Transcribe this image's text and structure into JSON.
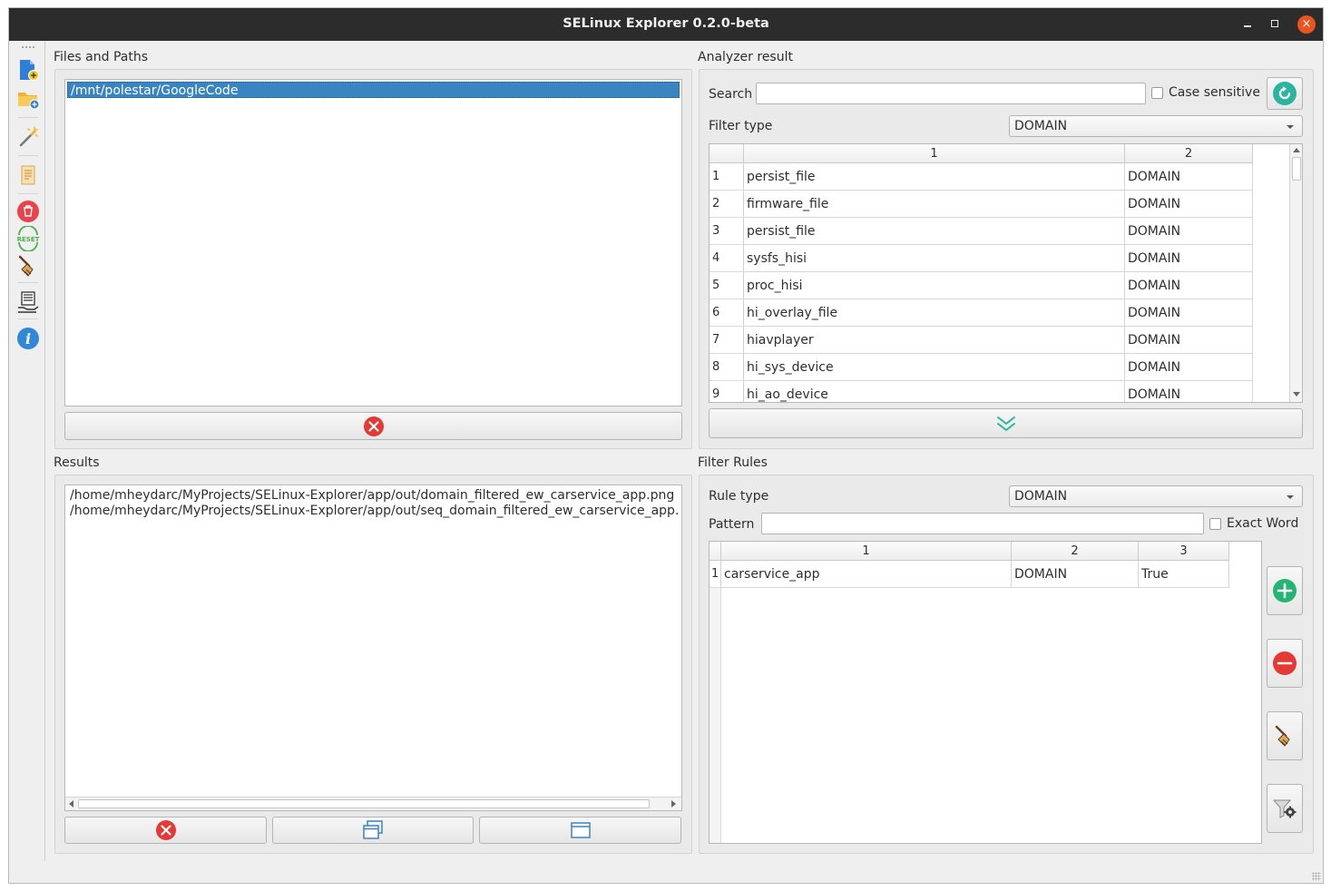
{
  "window": {
    "title": "SELinux Explorer 0.2.0-beta",
    "close_glyph": "×"
  },
  "toolbar": {
    "icons": [
      "add-file-icon",
      "add-folder-icon",
      "magic-wand-icon",
      "document-icon",
      "trash-icon",
      "reset-icon",
      "broom-icon",
      "server-hand-icon",
      "info-icon"
    ],
    "reset_text": "RESET",
    "info_glyph": "i"
  },
  "files_paths": {
    "label": "Files and Paths",
    "items": [
      "/mnt/polestar/GoogleCode"
    ]
  },
  "analyzer": {
    "label": "Analyzer result",
    "search_label": "Search",
    "search_value": "",
    "case_sensitive_label": "Case sensitive",
    "filter_type_label": "Filter type",
    "filter_type_value": "DOMAIN",
    "columns": [
      "1",
      "2"
    ],
    "rows": [
      {
        "num": "1",
        "name": "persist_file",
        "type": "DOMAIN"
      },
      {
        "num": "2",
        "name": "firmware_file",
        "type": "DOMAIN"
      },
      {
        "num": "3",
        "name": "persist_file",
        "type": "DOMAIN"
      },
      {
        "num": "4",
        "name": "sysfs_hisi",
        "type": "DOMAIN"
      },
      {
        "num": "5",
        "name": "proc_hisi",
        "type": "DOMAIN"
      },
      {
        "num": "6",
        "name": "hi_overlay_file",
        "type": "DOMAIN"
      },
      {
        "num": "7",
        "name": "hiavplayer",
        "type": "DOMAIN"
      },
      {
        "num": "8",
        "name": "hi_sys_device",
        "type": "DOMAIN"
      },
      {
        "num": "9",
        "name": "hi_ao_device",
        "type": "DOMAIN"
      }
    ]
  },
  "results": {
    "label": "Results",
    "items": [
      "/home/mheydarc/MyProjects/SELinux-Explorer/app/out/domain_filtered_ew_carservice_app.png",
      "/home/mheydarc/MyProjects/SELinux-Explorer/app/out/seq_domain_filtered_ew_carservice_app.p"
    ]
  },
  "filter_rules": {
    "label": "Filter Rules",
    "rule_type_label": "Rule type",
    "rule_type_value": "DOMAIN",
    "pattern_label": "Pattern",
    "pattern_value": "",
    "exact_word_label": "Exact Word",
    "columns": [
      "1",
      "2",
      "3"
    ],
    "rows": [
      {
        "num": "1",
        "pattern": "carservice_app",
        "type": "DOMAIN",
        "exact": "True"
      }
    ]
  },
  "colors": {
    "selection": "#3a84c2",
    "close_red": "#e53935",
    "add_green": "#22b573",
    "teal": "#2bb5a0",
    "title_bar": "#2c2c2c"
  }
}
